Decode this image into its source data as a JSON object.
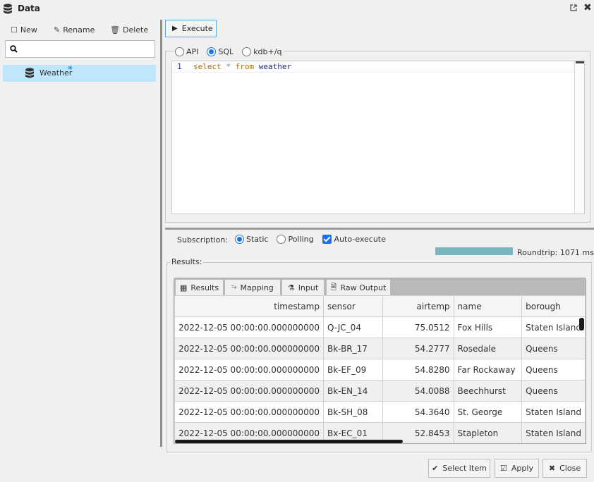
{
  "window": {
    "title": "Data",
    "icons": {
      "title": "database-icon",
      "popout": "popout-icon",
      "close": "close-icon"
    }
  },
  "left_panel": {
    "toolbar": [
      {
        "label": "New",
        "icon": "new-icon"
      },
      {
        "label": "Rename",
        "icon": "edit-icon"
      },
      {
        "label": "Delete",
        "icon": "trash-icon"
      }
    ],
    "search": {
      "value": "",
      "placeholder": ""
    },
    "tree": [
      {
        "label": "Weather",
        "modified_marker": "*",
        "selected": true,
        "icon": "database-icon"
      }
    ]
  },
  "query": {
    "execute_label": "Execute",
    "modes": [
      {
        "label": "API",
        "selected": false
      },
      {
        "label": "SQL",
        "selected": true
      },
      {
        "label": "kdb+/q",
        "selected": false
      }
    ],
    "editor": {
      "line_number": "1",
      "tokens": {
        "select": "select",
        "star": "*",
        "from": "from",
        "table": "weather"
      }
    }
  },
  "subscription": {
    "label": "Subscription:",
    "options": [
      {
        "label": "Static",
        "selected": true
      },
      {
        "label": "Polling",
        "selected": false
      }
    ],
    "auto_execute": {
      "label": "Auto-execute",
      "checked": true
    },
    "progress_percent": 100,
    "roundtrip": "Roundtrip: 1071 ms"
  },
  "results": {
    "group_label": "Results:",
    "tabs": [
      {
        "label": "Results",
        "icon": "table-icon"
      },
      {
        "label": "Mapping",
        "icon": "mapping-icon"
      },
      {
        "label": "Input",
        "icon": "flask-icon"
      },
      {
        "label": "Raw Output",
        "icon": "document-icon"
      }
    ],
    "columns": [
      "timestamp",
      "sensor",
      "airtemp",
      "name",
      "borough"
    ],
    "rows": [
      [
        "2022-12-05 00:00:00.000000000",
        "Q-JC_04",
        "75.0512",
        "Fox Hills",
        "Staten Island"
      ],
      [
        "2022-12-05 00:00:00.000000000",
        "Bk-BR_17",
        "54.2777",
        "Rosedale",
        "Queens"
      ],
      [
        "2022-12-05 00:00:00.000000000",
        "Bk-EF_09",
        "54.8280",
        "Far Rockaway",
        "Queens"
      ],
      [
        "2022-12-05 00:00:00.000000000",
        "Bk-EN_14",
        "54.0088",
        "Beechhurst",
        "Queens"
      ],
      [
        "2022-12-05 00:00:00.000000000",
        "Bk-SH_08",
        "54.3640",
        "St. George",
        "Staten Island"
      ],
      [
        "2022-12-05 00:00:00.000000000",
        "Bx-EC_01",
        "52.8453",
        "Stapleton",
        "Staten Island"
      ]
    ]
  },
  "footer": {
    "select_item": "Select Item",
    "apply": "Apply",
    "close": "Close"
  }
}
